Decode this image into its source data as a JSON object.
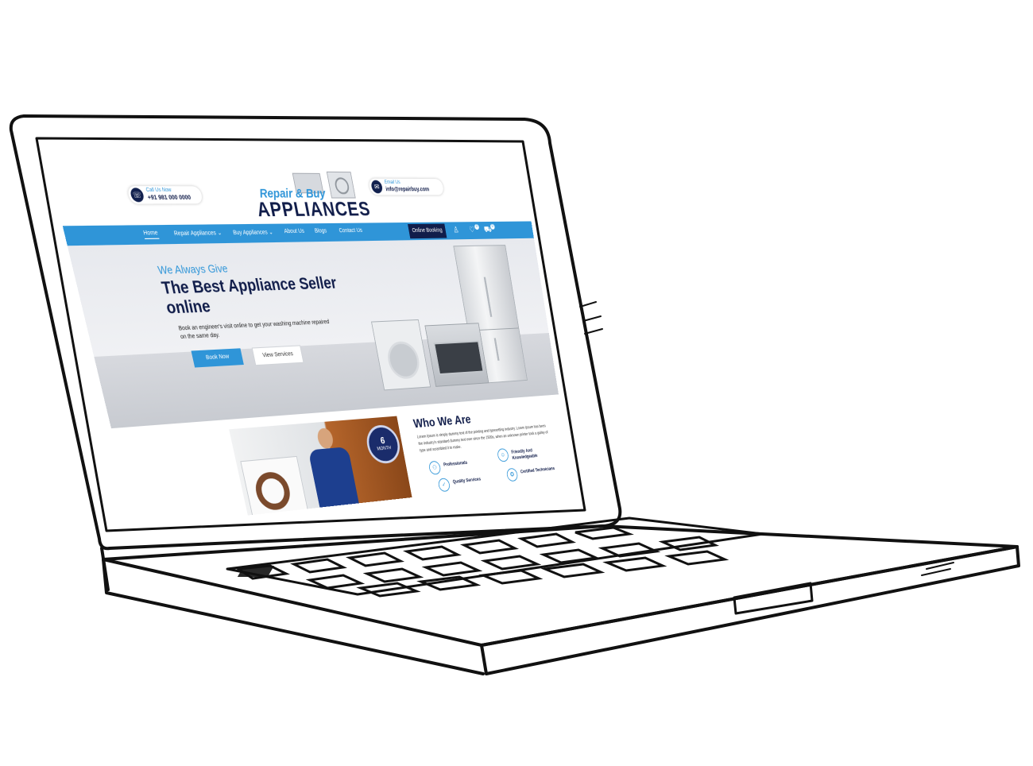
{
  "header": {
    "call_label": "Call Us Now",
    "call_number": "+91 981 000 0000",
    "email_label": "Email Us",
    "email_value": "info@repairbuy.com",
    "logo_line1": "Repair & Buy",
    "logo_line2": "APPLIANCES",
    "phone_icon": "phone-icon",
    "email_icon": "mail-icon"
  },
  "nav": {
    "items": [
      "Home",
      "Repair Appliances",
      "Buy Appliances",
      "About Us",
      "Blogs",
      "Contact Us"
    ],
    "book_label": "Online Booking",
    "wishlist_count": "0",
    "cart_count": "0",
    "icons": [
      "user-icon",
      "heart-icon",
      "cart-icon"
    ]
  },
  "hero": {
    "eyebrow": "We Always Give",
    "title": "The Best Appliance Seller online",
    "description": "Book an engineer's visit online to get your washing machine repaired on the same day.",
    "primary_button": "Book Now",
    "secondary_button": "View Services"
  },
  "who": {
    "title": "Who We Are",
    "body": "Lorem Ipsum is simply dummy text of the printing and typesetting industry. Lorem Ipsum has been the industry's standard dummy text ever since the 1500s, when an unknown printer took a galley of type and scrambled it to make.",
    "badge_number": "6",
    "badge_unit": "MONTH",
    "features": [
      "Professionals",
      "Friendly And Knowledgeable",
      "Quality Services",
      "Certified Technicians"
    ]
  },
  "colors": {
    "brand_blue": "#2f95d8",
    "brand_navy": "#111d4a"
  }
}
